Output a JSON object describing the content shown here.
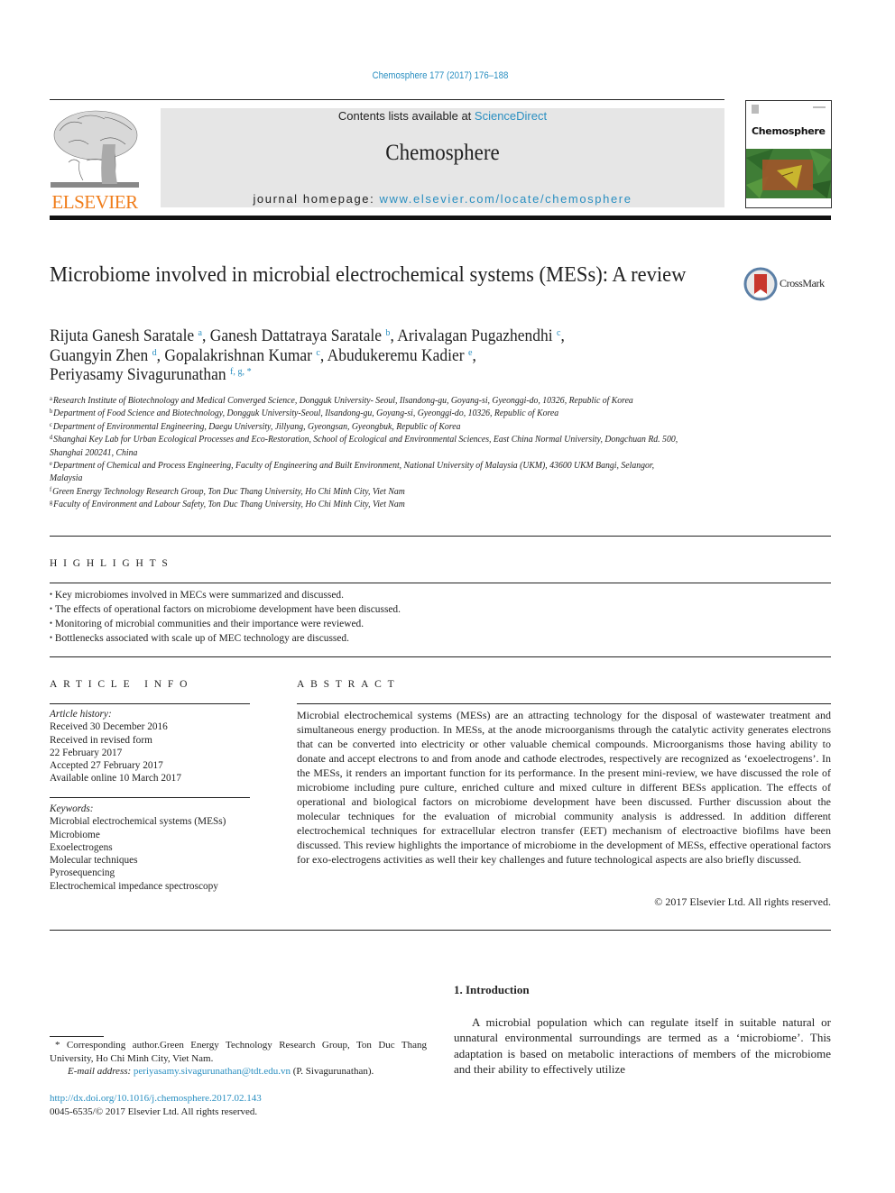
{
  "header": {
    "journal_reference": "Chemosphere 177 (2017) 176–188",
    "contents_prefix": "Contents lists available at ",
    "contents_link": "ScienceDirect",
    "journal_name": "Chemosphere",
    "homepage_prefix": "journal homepage: ",
    "homepage_link": "www.elsevier.com/locate/chemosphere",
    "publisher_logo_text": "ELSEVIER",
    "publisher_logo_icon": "elsevier-tree-icon",
    "cover_title": "Chemosphere",
    "colors": {
      "link": "#2a8fc1",
      "publisher_orange": "#f07d1a",
      "band_gray": "#e6e6e6"
    }
  },
  "article": {
    "title": "Microbiome involved in microbial electrochemical systems (MESs): A review",
    "crossmark_label": "CrossMark",
    "crossmark_icon": "crossmark-icon",
    "authors": [
      {
        "name": "Rijuta Ganesh Saratale",
        "sup": "a",
        "sep": ", "
      },
      {
        "name": "Ganesh Dattatraya Saratale",
        "sup": "b",
        "sep": ", "
      },
      {
        "name": "Arivalagan Pugazhendhi",
        "sup": "c",
        "sep": ", "
      },
      {
        "name": "Guangyin Zhen",
        "sup": "d",
        "sep": ", "
      },
      {
        "name": "Gopalakrishnan Kumar",
        "sup": "c",
        "sep": ", "
      },
      {
        "name": "Abudukeremu Kadier",
        "sup": "e",
        "sep": ", "
      },
      {
        "name": "Periyasamy Sivagurunathan",
        "sup": "f, g, *",
        "sep": ""
      }
    ],
    "affiliations": [
      {
        "key": "a",
        "text": "Research Institute of Biotechnology and Medical Converged Science, Dongguk University- Seoul, Ilsandong-gu, Goyang-si, Gyeonggi-do, 10326, Republic of Korea"
      },
      {
        "key": "b",
        "text": "Department of Food Science and Biotechnology, Dongguk University-Seoul, Ilsandong-gu, Goyang-si, Gyeonggi-do, 10326, Republic of Korea"
      },
      {
        "key": "c",
        "text": "Department of Environmental Engineering, Daegu University, Jillyang, Gyeongsan, Gyeongbuk, Republic of Korea"
      },
      {
        "key": "d",
        "text": "Shanghai Key Lab for Urban Ecological Processes and Eco-Restoration, School of Ecological and Environmental Sciences, East China Normal University, Dongchuan Rd. 500, Shanghai 200241, China"
      },
      {
        "key": "e",
        "text": "Department of Chemical and Process Engineering, Faculty of Engineering and Built Environment, National University of Malaysia (UKM), 43600 UKM Bangi, Selangor, Malaysia"
      },
      {
        "key": "f",
        "text": "Green Energy Technology Research Group, Ton Duc Thang University, Ho Chi Minh City, Viet Nam"
      },
      {
        "key": "g",
        "text": "Faculty of Environment and Labour Safety, Ton Duc Thang University, Ho Chi Minh City, Viet Nam"
      }
    ]
  },
  "highlights": {
    "heading": "HIGHLIGHTS",
    "items": [
      "Key microbiomes involved in MECs were summarized and discussed.",
      "The effects of operational factors on microbiome development have been discussed.",
      "Monitoring of microbial communities and their importance were reviewed.",
      "Bottlenecks associated with scale up of MEC technology are discussed."
    ]
  },
  "article_info": {
    "heading": "ARTICLE INFO",
    "history_label": "Article history:",
    "history": [
      "Received 30 December 2016",
      "Received in revised form",
      "22 February 2017",
      "Accepted 27 February 2017",
      "Available online 10 March 2017"
    ],
    "keywords_label": "Keywords:",
    "keywords": [
      "Microbial electrochemical systems (MESs)",
      "Microbiome",
      "Exoelectrogens",
      "Molecular techniques",
      "Pyrosequencing",
      "Electrochemical impedance spectroscopy"
    ]
  },
  "abstract": {
    "heading": "ABSTRACT",
    "text": "Microbial electrochemical systems (MESs) are an attracting technology for the disposal of wastewater treatment and simultaneous energy production. In MESs, at the anode microorganisms through the catalytic activity generates electrons that can be converted into electricity or other valuable chemical compounds. Microorganisms those having ability to donate and accept electrons to and from anode and cathode electrodes, respectively are recognized as ‘exoelectrogens’. In the MESs, it renders an important function for its performance. In the present mini-review, we have discussed the role of microbiome including pure culture, enriched culture and mixed culture in different BESs application. The effects of operational and biological factors on microbiome development have been discussed. Further discussion about the molecular techniques for the evaluation of microbial community analysis is addressed. In addition different electrochemical techniques for extracellular electron transfer (EET) mechanism of electroactive biofilms have been discussed. This review highlights the importance of microbiome in the development of MESs, effective operational factors for exo-electrogens activities as well their key chal­lenges and future technological aspects are also briefly discussed.",
    "copyright": "© 2017 Elsevier Ltd. All rights reserved."
  },
  "footnotes": {
    "corresponding": "* Corresponding author.Green Energy Technology Research Group, Ton Duc Thang University, Ho Chi Minh City, Viet Nam.",
    "email_label": "E-mail address: ",
    "email": "periyasamy.sivagurunathan@tdt.edu.vn",
    "email_suffix": " (P. Sivagurunathan).",
    "doi": "http://dx.doi.org/10.1016/j.chemosphere.2017.02.143",
    "issn_copyright": "0045-6535/© 2017 Elsevier Ltd. All rights reserved."
  },
  "introduction": {
    "heading": "1.  Introduction",
    "text": "A microbial population which can regulate itself in suitable natural or unnatural environmental surroundings are termed as a ‘microbiome’. This adaptation is based on metabolic interactions of members of the microbiome and their ability to effectively utilize"
  }
}
